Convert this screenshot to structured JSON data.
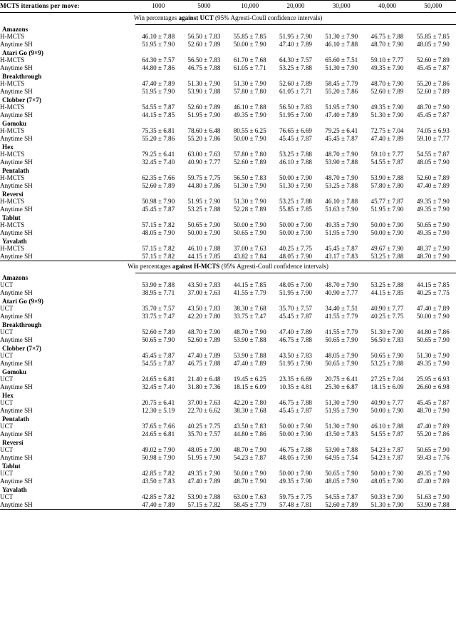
{
  "header": {
    "row_title": "MCTS iterations per move:",
    "iterations": [
      "1000",
      "5000",
      "10,000",
      "20,000",
      "30,000",
      "40,000",
      "50,000"
    ]
  },
  "sections": [
    {
      "caption_pre": "Win percentages ",
      "caption_bold": "against UCT",
      "caption_post": " (95% Agresti-Coull confidence intervals)",
      "groups": [
        {
          "name": "Amazons",
          "rows": [
            {
              "label": "H-MCTS",
              "values": [
                "46.10 ± 7.88",
                "56.50 ± 7.83",
                "55.85 ± 7.85",
                "51.95 ± 7.90",
                "51.30 ± 7.90",
                "46.75 ± 7.88",
                "55.85 ± 7.85"
              ]
            },
            {
              "label": "Anytime SH",
              "values": [
                "51.95 ± 7.90",
                "52.60 ± 7.89",
                "50.00 ± 7.90",
                "47.40 ± 7.89",
                "46.10 ± 7.88",
                "48.70 ± 7.90",
                "48.05 ± 7.90"
              ]
            }
          ]
        },
        {
          "name": "Atari Go (9×9)",
          "rows": [
            {
              "label": "H-MCTS",
              "values": [
                "64.30 ± 7.57",
                "56.50 ± 7.83",
                "61.70 ± 7.68",
                "64.30 ± 7.57",
                "65.60 ± 7.51",
                "59.10 ± 7.77",
                "52.60 ± 7.89"
              ]
            },
            {
              "label": "Anytime SH",
              "values": [
                "44.80 ± 7.86",
                "46.75 ± 7.88",
                "61.05 ± 7.71",
                "53.25 ± 7.88",
                "51.30 ± 7.90",
                "49.35 ± 7.90",
                "45.45 ± 7.87"
              ]
            }
          ]
        },
        {
          "name": "Breakthrough",
          "rows": [
            {
              "label": "H-MCTS",
              "values": [
                "47.40 ± 7.89",
                "51.30 ± 7.90",
                "51.30 ± 7.90",
                "52.60 ± 7.89",
                "58.45 ± 7.79",
                "48.70 ± 7.90",
                "55.20 ± 7.86"
              ]
            },
            {
              "label": "Anytime SH",
              "values": [
                "51.95 ± 7.90",
                "53.90 ± 7.88",
                "57.80 ± 7.80",
                "61.05 ± 7.71",
                "55.20 ± 7.86",
                "52.60 ± 7.89",
                "52.60 ± 7.89"
              ]
            }
          ]
        },
        {
          "name": "Clobber (7×7)",
          "rows": [
            {
              "label": "H-MCTS",
              "values": [
                "54.55 ± 7.87",
                "52.60 ± 7.89",
                "46.10 ± 7.88",
                "56.50 ± 7.83",
                "51.95 ± 7.90",
                "49.35 ± 7.90",
                "48.70 ± 7.90"
              ]
            },
            {
              "label": "Anytime SH",
              "values": [
                "44.15 ± 7.85",
                "51.95 ± 7.90",
                "49.35 ± 7.90",
                "51.95 ± 7.90",
                "47.40 ± 7.89",
                "51.30 ± 7.90",
                "45.45 ± 7.87"
              ]
            }
          ]
        },
        {
          "name": "Gomoku",
          "rows": [
            {
              "label": "H-MCTS",
              "values": [
                "75.35 ± 6.81",
                "78.60 ± 6.48",
                "80.55 ± 6.25",
                "76.65 ± 6.69",
                "79.25 ± 6.41",
                "72.75 ± 7.04",
                "74.05 ± 6.93"
              ]
            },
            {
              "label": "Anytime SH",
              "values": [
                "55.20 ± 7.86",
                "55.20 ± 7.86",
                "50.00 ± 7.90",
                "45.45 ± 7.87",
                "45.45 ± 7.87",
                "47.40 ± 7.89",
                "59.10 ± 7.77"
              ]
            }
          ]
        },
        {
          "name": "Hex",
          "rows": [
            {
              "label": "H-MCTS",
              "values": [
                "79.25 ± 6.41",
                "63.00 ± 7.63",
                "57.80 ± 7.80",
                "53.25 ± 7.88",
                "48.70 ± 7.90",
                "59.10 ± 7.77",
                "54.55 ± 7.87"
              ]
            },
            {
              "label": "Anytime SH",
              "values": [
                "32.45 ± 7.40",
                "40.90 ± 7.77",
                "52.60 ± 7.89",
                "46.10 ± 7.88",
                "53.90 ± 7.88",
                "54.55 ± 7.87",
                "48.05 ± 7.90"
              ]
            }
          ]
        },
        {
          "name": "Pentalath",
          "rows": [
            {
              "label": "H-MCTS",
              "values": [
                "62.35 ± 7.66",
                "59.75 ± 7.75",
                "56.50 ± 7.83",
                "50.00 ± 7.90",
                "48.70 ± 7.90",
                "53.90 ± 7.88",
                "52.60 ± 7.89"
              ]
            },
            {
              "label": "Anytime SH",
              "values": [
                "52.60 ± 7.89",
                "44.80 ± 7.86",
                "51.30 ± 7.90",
                "51.30 ± 7.90",
                "53.25 ± 7.88",
                "57.80 ± 7.80",
                "47.40 ± 7.89"
              ]
            }
          ]
        },
        {
          "name": "Reversi",
          "rows": [
            {
              "label": "H-MCTS",
              "values": [
                "50.98 ± 7.90",
                "51.95 ± 7.90",
                "51.30 ± 7.90",
                "53.25 ± 7.88",
                "46.10 ± 7.88",
                "45.77 ± 7.87",
                "49.35 ± 7.90"
              ]
            },
            {
              "label": "Anytime SH",
              "values": [
                "45.45 ± 7.87",
                "53.25 ± 7.88",
                "52.28 ± 7.89",
                "55.85 ± 7.85",
                "51.63 ± 7.90",
                "51.95 ± 7.90",
                "49.35 ± 7.90"
              ]
            }
          ]
        },
        {
          "name": "Tablut",
          "rows": [
            {
              "label": "H-MCTS",
              "values": [
                "57.15 ± 7.82",
                "50.65 ± 7.90",
                "50.00 ± 7.90",
                "50.00 ± 7.90",
                "49.35 ± 7.90",
                "50.00 ± 7.90",
                "50.65 ± 7.90"
              ]
            },
            {
              "label": "Anytime SH",
              "values": [
                "48.05 ± 7.90",
                "50.00 ± 7.90",
                "50.65 ± 7.90",
                "50.00 ± 7.90",
                "51.95 ± 7.90",
                "50.00 ± 7.90",
                "49.35 ± 7.90"
              ]
            }
          ]
        },
        {
          "name": "Yavalath",
          "rows": [
            {
              "label": "H-MCTS",
              "values": [
                "57.15 ± 7.82",
                "46.10 ± 7.88",
                "37.00 ± 7.63",
                "40.25 ± 7.75",
                "45.45 ± 7.87",
                "49.67 ± 7.90",
                "48.37 ± 7.90"
              ]
            },
            {
              "label": "Anytime SH",
              "values": [
                "57.15 ± 7.82",
                "44.15 ± 7.85",
                "43.82 ± 7.84",
                "48.05 ± 7.90",
                "43.17 ± 7.83",
                "53.25 ± 7.88",
                "48.70 ± 7.90"
              ]
            }
          ]
        }
      ]
    },
    {
      "caption_pre": "Win percentages ",
      "caption_bold": "against H-MCTS",
      "caption_post": " (95% Agresti-Coull confidence intervals)",
      "groups": [
        {
          "name": "Amazons",
          "rows": [
            {
              "label": "UCT",
              "values": [
                "53.90 ± 7.88",
                "43.50 ± 7.83",
                "44.15 ± 7.85",
                "48.05 ± 7.90",
                "48.70 ± 7.90",
                "53.25 ± 7.88",
                "44.15 ± 7.85"
              ]
            },
            {
              "label": "Anytime SH",
              "values": [
                "38.95 ± 7.71",
                "37.00 ± 7.63",
                "41.55 ± 7.79",
                "51.95 ± 7.90",
                "40.90 ± 7.77",
                "44.15 ± 7.85",
                "40.25 ± 7.75"
              ]
            }
          ]
        },
        {
          "name": "Atari Go (9×9)",
          "rows": [
            {
              "label": "UCT",
              "values": [
                "35.70 ± 7.57",
                "43.50 ± 7.83",
                "38.30 ± 7.68",
                "35.70 ± 7.57",
                "34.40 ± 7.51",
                "40.90 ± 7.77",
                "47.40 ± 7.89"
              ]
            },
            {
              "label": "Anytime SH",
              "values": [
                "33.75 ± 7.47",
                "42.20 ± 7.80",
                "33.75 ± 7.47",
                "45.45 ± 7.87",
                "41.55 ± 7.79",
                "40.25 ± 7.75",
                "50.00 ± 7.90"
              ]
            }
          ]
        },
        {
          "name": "Breakthrough",
          "rows": [
            {
              "label": "UCT",
              "values": [
                "52.60 ± 7.89",
                "48.70 ± 7.90",
                "48.70 ± 7.90",
                "47.40 ± 7.89",
                "41.55 ± 7.79",
                "51.30 ± 7.90",
                "44.80 ± 7.86"
              ]
            },
            {
              "label": "Anytime SH",
              "values": [
                "50.65 ± 7.90",
                "52.60 ± 7.89",
                "53.90 ± 7.88",
                "46.75 ± 7.88",
                "50.65 ± 7.90",
                "56.50 ± 7.83",
                "50.65 ± 7.90"
              ]
            }
          ]
        },
        {
          "name": "Clobber (7×7)",
          "rows": [
            {
              "label": "UCT",
              "values": [
                "45.45 ± 7.87",
                "47.40 ± 7.89",
                "53.90 ± 7.88",
                "43.50 ± 7.83",
                "48.05 ± 7.90",
                "50.65 ± 7.90",
                "51.30 ± 7.90"
              ]
            },
            {
              "label": "Anytime SH",
              "values": [
                "54.55 ± 7.87",
                "46.75 ± 7.88",
                "47.40 ± 7.89",
                "51.95 ± 7.90",
                "50.65 ± 7.90",
                "53.25 ± 7.88",
                "49.35 ± 7.90"
              ]
            }
          ]
        },
        {
          "name": "Gomoku",
          "rows": [
            {
              "label": "UCT",
              "values": [
                "24.65 ± 6.81",
                "21.40 ± 6.48",
                "19.45 ± 6.25",
                "23.35 ± 6.69",
                "20.75 ± 6.41",
                "27.25 ± 7.04",
                "25.95 ± 6.93"
              ]
            },
            {
              "label": "Anytime SH",
              "values": [
                "32.45 ± 7.40",
                "31.80 ± 7.36",
                "18.15 ± 6.09",
                "10.35 ± 4.81",
                "25.30 ± 6.87",
                "18.15 ± 6.09",
                "26.60 ± 6.98"
              ]
            }
          ]
        },
        {
          "name": "Hex",
          "rows": [
            {
              "label": "UCT",
              "values": [
                "20.75 ± 6.41",
                "37.00 ± 7.63",
                "42.20 ± 7.80",
                "46.75 ± 7.88",
                "51.30 ± 7.90",
                "40.90 ± 7.77",
                "45.45 ± 7.87"
              ]
            },
            {
              "label": "Anytime SH",
              "values": [
                "12.30 ± 5.19",
                "22.70 ± 6.62",
                "38.30 ± 7.68",
                "45.45 ± 7.87",
                "51.95 ± 7.90",
                "50.00 ± 7.90",
                "48.70 ± 7.90"
              ]
            }
          ]
        },
        {
          "name": "Pentalath",
          "rows": [
            {
              "label": "UCT",
              "values": [
                "37.65 ± 7.66",
                "40.25 ± 7.75",
                "43.50 ± 7.83",
                "50.00 ± 7.90",
                "51.30 ± 7.90",
                "46.10 ± 7.88",
                "47.40 ± 7.89"
              ]
            },
            {
              "label": "Anytime SH",
              "values": [
                "24.65 ± 6.81",
                "35.70 ± 7.57",
                "44.80 ± 7.86",
                "50.00 ± 7.90",
                "43.50 ± 7.83",
                "54.55 ± 7.87",
                "55.20 ± 7.86"
              ]
            }
          ]
        },
        {
          "name": "Reversi",
          "rows": [
            {
              "label": "UCT",
              "values": [
                "49.02 ± 7.90",
                "48.05 ± 7.90",
                "48.70 ± 7.90",
                "46.75 ± 7.88",
                "53.90 ± 7.88",
                "54.23 ± 7.87",
                "50.65 ± 7.90"
              ]
            },
            {
              "label": "Anytime SH",
              "values": [
                "50.98 ± 7.90",
                "51.95 ± 7.90",
                "54.23 ± 7.87",
                "48.05 ± 7.90",
                "64.95 ± 7.54",
                "54.23 ± 7.87",
                "59.43 ± 7.76"
              ]
            }
          ]
        },
        {
          "name": "Tablut",
          "rows": [
            {
              "label": "UCT",
              "values": [
                "42.85 ± 7.82",
                "49.35 ± 7.90",
                "50.00 ± 7.90",
                "50.00 ± 7.90",
                "50.65 ± 7.90",
                "50.00 ± 7.90",
                "49.35 ± 7.90"
              ]
            },
            {
              "label": "Anytime SH",
              "values": [
                "43.50 ± 7.83",
                "47.40 ± 7.89",
                "48.70 ± 7.90",
                "49.35 ± 7.90",
                "48.05 ± 7.90",
                "48.05 ± 7.90",
                "47.40 ± 7.89"
              ]
            }
          ]
        },
        {
          "name": "Yavalath",
          "rows": [
            {
              "label": "UCT",
              "values": [
                "42.85 ± 7.82",
                "53.90 ± 7.88",
                "63.00 ± 7.63",
                "59.75 ± 7.75",
                "54.55 ± 7.87",
                "50.33 ± 7.90",
                "51.63 ± 7.90"
              ]
            },
            {
              "label": "Anytime SH",
              "values": [
                "47.40 ± 7.89",
                "57.15 ± 7.82",
                "58.45 ± 7.79",
                "57.48 ± 7.81",
                "52.60 ± 7.89",
                "51.30 ± 7.90",
                "53.90 ± 7.88"
              ]
            }
          ]
        }
      ]
    }
  ]
}
